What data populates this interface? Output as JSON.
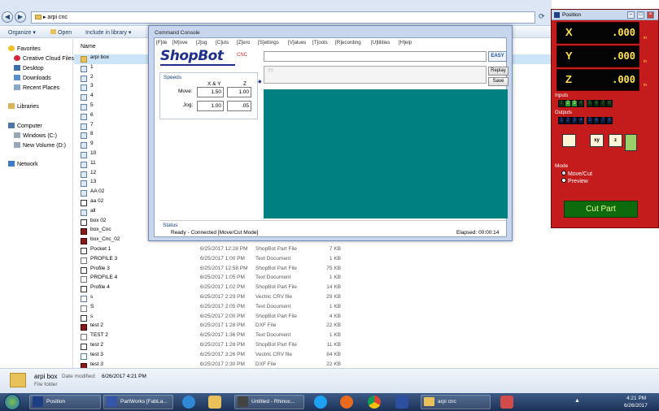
{
  "explorer": {
    "path": "arpi cnc",
    "toolbar": {
      "organize": "Organize ▾",
      "open": "Open",
      "include": "Include in library ▾"
    },
    "nav": {
      "favorites": "Favorites",
      "items": [
        "Creative Cloud Files",
        "Desktop",
        "Downloads",
        "Recent Places"
      ],
      "libraries": "Libraries",
      "computer": "Computer",
      "drives": [
        "Windows (C:)",
        "New Volume (D:)"
      ],
      "network": "Network"
    },
    "column_name": "Name",
    "files": [
      {
        "name": "arpi box",
        "icon": "folder-icon",
        "date": "",
        "type": "",
        "size": ""
      },
      {
        "name": "1",
        "icon": "image-file-icon",
        "date": "",
        "type": "",
        "size": ""
      },
      {
        "name": "2",
        "icon": "image-file-icon",
        "date": "",
        "type": "",
        "size": ""
      },
      {
        "name": "3",
        "icon": "image-file-icon",
        "date": "",
        "type": "",
        "size": ""
      },
      {
        "name": "4",
        "icon": "image-file-icon",
        "date": "",
        "type": "",
        "size": ""
      },
      {
        "name": "5",
        "icon": "image-file-icon",
        "date": "",
        "type": "",
        "size": ""
      },
      {
        "name": "6",
        "icon": "image-file-icon",
        "date": "",
        "type": "",
        "size": ""
      },
      {
        "name": "7",
        "icon": "image-file-icon",
        "date": "",
        "type": "",
        "size": ""
      },
      {
        "name": "8",
        "icon": "image-file-icon",
        "date": "",
        "type": "",
        "size": ""
      },
      {
        "name": "9",
        "icon": "image-file-icon",
        "date": "",
        "type": "",
        "size": ""
      },
      {
        "name": "10",
        "icon": "image-file-icon",
        "date": "",
        "type": "",
        "size": ""
      },
      {
        "name": "11",
        "icon": "image-file-icon",
        "date": "",
        "type": "",
        "size": ""
      },
      {
        "name": "12",
        "icon": "image-file-icon",
        "date": "",
        "type": "",
        "size": ""
      },
      {
        "name": "13",
        "icon": "image-file-icon",
        "date": "",
        "type": "",
        "size": ""
      },
      {
        "name": "AA 02",
        "icon": "image-file-icon",
        "date": "",
        "type": "",
        "size": ""
      },
      {
        "name": "aa 02",
        "icon": "shopbot-file-icon",
        "date": "",
        "type": "",
        "size": ""
      },
      {
        "name": "all",
        "icon": "image-file-icon",
        "date": "",
        "type": "",
        "size": ""
      },
      {
        "name": "box 02",
        "icon": "shopbot-file-icon",
        "date": "",
        "type": "",
        "size": ""
      },
      {
        "name": "box_Cnc",
        "icon": "dxf-file-icon",
        "date": "",
        "type": "",
        "size": ""
      },
      {
        "name": "box_Cnc_02",
        "icon": "dxf-file-icon",
        "date": "",
        "type": "",
        "size": ""
      },
      {
        "name": "Pocket 1",
        "icon": "shopbot-file-icon",
        "date": "6/25/2017 12:28 PM",
        "type": "ShopBot Part File",
        "size": "7 KB"
      },
      {
        "name": "PROFILE 3",
        "icon": "text-file-icon",
        "date": "6/25/2017 1:00 PM",
        "type": "Text Document",
        "size": "1 KB"
      },
      {
        "name": "Profile 3",
        "icon": "shopbot-file-icon",
        "date": "6/25/2017 12:58 PM",
        "type": "ShopBot Part File",
        "size": "75 KB"
      },
      {
        "name": "PROFILE 4",
        "icon": "text-file-icon",
        "date": "6/25/2017 1:05 PM",
        "type": "Text Document",
        "size": "1 KB"
      },
      {
        "name": "Profile 4",
        "icon": "shopbot-file-icon",
        "date": "6/25/2017 1:02 PM",
        "type": "ShopBot Part File",
        "size": "14 KB"
      },
      {
        "name": "s",
        "icon": "vectric-file-icon",
        "date": "6/25/2017 2:29 PM",
        "type": "Vectric CRV file",
        "size": "29 KB"
      },
      {
        "name": "S",
        "icon": "text-file-icon",
        "date": "6/25/2017 2:05 PM",
        "type": "Text Document",
        "size": "1 KB"
      },
      {
        "name": "s",
        "icon": "shopbot-file-icon",
        "date": "6/25/2017 2:00 PM",
        "type": "ShopBot Part File",
        "size": "4 KB"
      },
      {
        "name": "test 2",
        "icon": "dxf-file-icon",
        "date": "6/25/2017 1:28 PM",
        "type": "DXF File",
        "size": "22 KB"
      },
      {
        "name": "TEST 2",
        "icon": "text-file-icon",
        "date": "6/25/2017 1:36 PM",
        "type": "Text Document",
        "size": "1 KB"
      },
      {
        "name": "test 2",
        "icon": "shopbot-file-icon",
        "date": "6/25/2017 1:28 PM",
        "type": "ShopBot Part File",
        "size": "11 KB"
      },
      {
        "name": "test 3",
        "icon": "vectric-file-icon",
        "date": "6/25/2017 3:26 PM",
        "type": "Vectric CRV file",
        "size": "84 KB"
      },
      {
        "name": "test 3",
        "icon": "dxf-file-icon",
        "date": "6/25/2017 2:30 PM",
        "type": "DXF File",
        "size": "22 KB"
      }
    ],
    "details": {
      "name": "arpi box",
      "modified_label": "Date modified:",
      "modified": "6/26/2017 4:21 PM",
      "kind": "File folder"
    }
  },
  "console": {
    "title": "Command Console",
    "menus": [
      "[F]ile",
      "[M]ove",
      "[J]og",
      "[C]uts",
      "[Z]ero",
      "[S]ettings",
      "[V]alues",
      "[T]ools",
      "[R]ecording",
      "[U]tilities",
      "[H]elp"
    ],
    "logo": "ShopBot",
    "logo_suffix": "CNC",
    "speeds_title": "Speeds",
    "col_xy": "X & Y",
    "col_z": "Z",
    "move_label": "Move:",
    "jog_label": "Jog:",
    "move_xy": "1.50",
    "move_z": "1.00",
    "jog_xy": "1.00",
    "jog_z": ".05",
    "easy": "EASY",
    "replay": "Replay",
    "save": "Save",
    "prompt_text": "??.",
    "status_title": "Status",
    "status": "Ready - Connected  [Move/Cut Mode]",
    "elapsed": "Elapsed: 00:00:14"
  },
  "position": {
    "title": "Position",
    "axes": [
      {
        "label": "X",
        "value": ".000",
        "unit": "in"
      },
      {
        "label": "Y",
        "value": ".000",
        "unit": "in"
      },
      {
        "label": "Z",
        "value": ".000",
        "unit": "in"
      }
    ],
    "inputs_label": "Inputs",
    "outputs_label": "Outputs",
    "inputs": [
      "1",
      "2",
      "3",
      "4",
      "5",
      "6",
      "7",
      "8"
    ],
    "outputs": [
      "1",
      "2",
      "3",
      "4",
      "5",
      "6",
      "7",
      "8"
    ],
    "mode_label": "Mode",
    "mode_options": [
      "Move/Cut",
      "Preview"
    ],
    "cut_part": "Cut Part",
    "colors": {
      "panel": "#c41c1c",
      "readout": "#ffe14d",
      "input_on": "#1f9e2a"
    }
  },
  "taskbar": {
    "items": [
      "Position",
      "PartWorks [FabLa...",
      "Untitled - Rhinoc...",
      "arpi cnc"
    ],
    "time": "4:21 PM",
    "date": "6/26/2017"
  }
}
